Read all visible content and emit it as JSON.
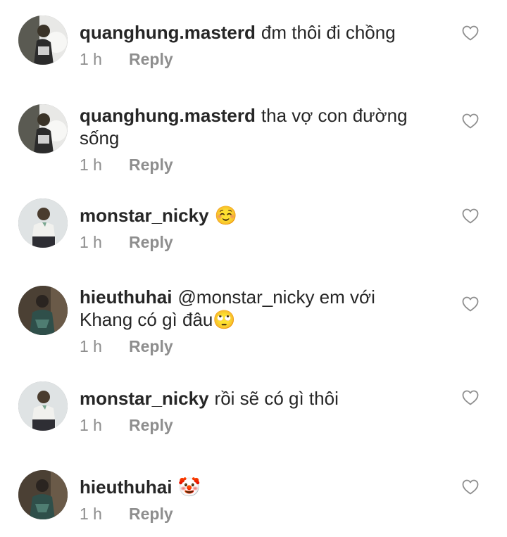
{
  "colors": {
    "text": "#262626",
    "meta": "#8e8e8e",
    "background": "#ffffff"
  },
  "reply_label": "Reply",
  "comments": [
    {
      "username": "quanghung.masterd",
      "text": "đm thôi đi chồng",
      "time": "1 h",
      "avatar": "avatar-quanghung"
    },
    {
      "username": "quanghung.masterd",
      "text": "tha vợ con đường sống",
      "time": "1 h",
      "avatar": "avatar-quanghung"
    },
    {
      "username": "monstar_nicky",
      "text": "☺️",
      "time": "1 h",
      "avatar": "avatar-monstar"
    },
    {
      "username": "hieuthuhai",
      "text": "@monstar_nicky em với Khang có gì đâu🙄",
      "time": "1 h",
      "avatar": "avatar-hieuthuhai"
    },
    {
      "username": "monstar_nicky",
      "text": "rồi sẽ có gì thôi",
      "time": "1 h",
      "avatar": "avatar-monstar"
    },
    {
      "username": "hieuthuhai",
      "text": "🤡",
      "time": "1 h",
      "avatar": "avatar-hieuthuhai"
    }
  ]
}
